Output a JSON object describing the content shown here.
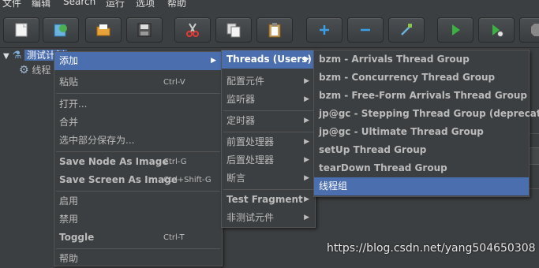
{
  "menubar": {
    "items": [
      "文件",
      "编辑",
      "Search",
      "运行",
      "选项",
      "帮助"
    ]
  },
  "toolbar": {
    "buttons": [
      "new-icon",
      "templates-icon",
      "open-icon",
      "save-icon",
      "cut-icon",
      "copy-icon",
      "paste-icon",
      "expand-icon",
      "collapse-icon",
      "toggle-icon",
      "start-icon",
      "start-no-pause-icon",
      "stop-icon"
    ]
  },
  "tree": {
    "root_label": "测试计划",
    "child_label": "线程"
  },
  "context_menu": {
    "items": [
      {
        "label": "添加",
        "submenu": true
      },
      {
        "label": "粘贴",
        "shortcut": "Ctrl-V"
      },
      {
        "label": "打开..."
      },
      {
        "label": "合并"
      },
      {
        "label": "选中部分保存为..."
      },
      {
        "label": "Save Node As Image",
        "shortcut": "Ctrl-G"
      },
      {
        "label": "Save Screen As Image",
        "shortcut": "Ctrl+Shift-G"
      },
      {
        "label": "启用"
      },
      {
        "label": "禁用"
      },
      {
        "label": "Toggle",
        "shortcut": "Ctrl-T"
      },
      {
        "label": "帮助"
      }
    ]
  },
  "add_menu": {
    "items": [
      {
        "label": "Threads (Users)",
        "submenu": true
      },
      {
        "label": "配置元件",
        "submenu": true
      },
      {
        "label": "监听器",
        "submenu": true
      },
      {
        "label": "定时器",
        "submenu": true
      },
      {
        "label": "前置处理器",
        "submenu": true
      },
      {
        "label": "后置处理器",
        "submenu": true
      },
      {
        "label": "断言",
        "submenu": true
      },
      {
        "label": "Test Fragment",
        "submenu": true
      },
      {
        "label": "非测试元件",
        "submenu": true
      }
    ]
  },
  "threads_menu": {
    "items": [
      {
        "label": "bzm - Arrivals Thread Group"
      },
      {
        "label": "bzm - Concurrency Thread Group"
      },
      {
        "label": "bzm - Free-Form Arrivals Thread Group"
      },
      {
        "label": "jp@gc - Stepping Thread Group (deprecated)"
      },
      {
        "label": "jp@gc - Ultimate Thread Group"
      },
      {
        "label": "setUp Thread Group"
      },
      {
        "label": "tearDown Thread Group"
      },
      {
        "label": "线程组"
      }
    ]
  },
  "right_panel": {
    "partial_label": "序"
  },
  "watermark": "https://blog.csdn.net/yang504650308",
  "colors": {
    "background": "#3c3f41",
    "highlight": "#4b6eaf",
    "text": "#bbbbbb"
  }
}
